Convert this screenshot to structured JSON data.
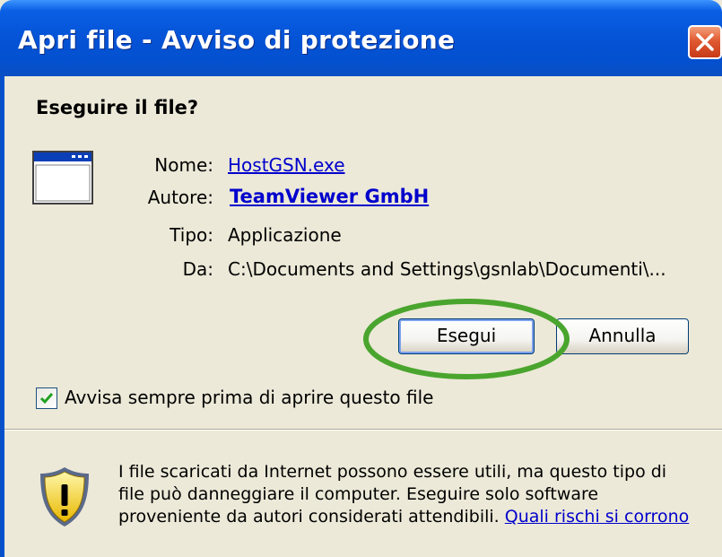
{
  "window": {
    "title": "Apri file - Avviso di protezione"
  },
  "dialog": {
    "heading": "Eseguire il file?",
    "fields": {
      "name_label": "Nome:",
      "name_value": "HostGSN.exe",
      "author_label": "Autore:",
      "author_value": "TeamViewer GmbH",
      "type_label": "Tipo:",
      "type_value": "Applicazione",
      "from_label": "Da:",
      "from_value": "C:\\Documents and Settings\\gsnlab\\Documenti\\..."
    },
    "buttons": {
      "run": "Esegui",
      "cancel": "Annulla"
    },
    "checkbox": {
      "label": "Avvisa sempre prima di aprire questo file",
      "checked": true
    },
    "warning": {
      "text": "I file scaricati da Internet possono essere utili, ma questo tipo di file può danneggiare il computer. Eseguire solo software proveniente da autori considerati attendibili.",
      "link": "Quali rischi si corrono"
    }
  },
  "colors": {
    "titlebar": "#0553d6",
    "dialog_bg": "#ece9d8",
    "link": "#0000cc",
    "highlight_ellipse": "#4aa52e",
    "close_button": "#e05a32"
  },
  "icons": {
    "program": "program-window-icon",
    "warning": "shield-warning-icon",
    "close": "close-icon",
    "check": "checkmark-icon"
  }
}
